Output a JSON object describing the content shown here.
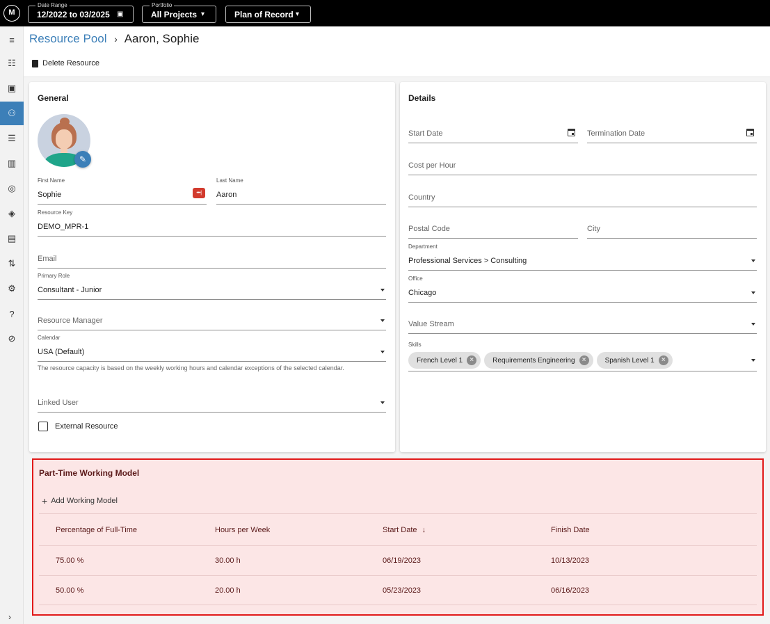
{
  "topbar": {
    "date_range_label": "Date Range",
    "date_range_value": "12/2022 to 03/2025",
    "portfolio_label": "Portfolio",
    "portfolio_value": "All Projects",
    "plan_value": "Plan of Record"
  },
  "breadcrumb": {
    "parent": "Resource Pool",
    "separator": "›",
    "current": "Aaron, Sophie"
  },
  "toolbar": {
    "delete_label": "Delete Resource"
  },
  "general": {
    "title": "General",
    "first_name_label": "First Name",
    "first_name_value": "Sophie",
    "last_name_label": "Last Name",
    "last_name_value": "Aaron",
    "resource_key_label": "Resource Key",
    "resource_key_value": "DEMO_MPR-1",
    "email_placeholder": "Email",
    "primary_role_label": "Primary Role",
    "primary_role_value": "Consultant - Junior",
    "resource_manager_placeholder": "Resource Manager",
    "calendar_label": "Calendar",
    "calendar_value": "USA (Default)",
    "calendar_hint": "The resource capacity is based on the weekly working hours and calendar exceptions of the selected calendar.",
    "linked_user_placeholder": "Linked User",
    "external_resource_label": "External Resource"
  },
  "details": {
    "title": "Details",
    "start_date_placeholder": "Start Date",
    "termination_date_placeholder": "Termination Date",
    "cost_per_hour_placeholder": "Cost per Hour",
    "country_placeholder": "Country",
    "postal_code_placeholder": "Postal Code",
    "city_placeholder": "City",
    "department_label": "Department",
    "department_value": "Professional Services > Consulting",
    "office_label": "Office",
    "office_value": "Chicago",
    "value_stream_placeholder": "Value Stream",
    "skills_label": "Skills",
    "skills": [
      "French Level 1",
      "Requirements Engineering",
      "Spanish Level 1"
    ]
  },
  "part_time": {
    "title": "Part-Time Working Model",
    "add_label": "Add Working Model",
    "columns": [
      "Percentage of Full-Time",
      "Hours per Week",
      "Start Date",
      "Finish Date"
    ],
    "sort_indicator": "↓",
    "rows": [
      [
        "75.00 %",
        "30.00 h",
        "06/19/2023",
        "10/13/2023"
      ],
      [
        "50.00 %",
        "20.00 h",
        "05/23/2023",
        "06/16/2023"
      ]
    ]
  },
  "colors": {
    "accent": "#3c7fb8",
    "highlight_border": "#e11919",
    "highlight_fill": "#fce6e6"
  }
}
